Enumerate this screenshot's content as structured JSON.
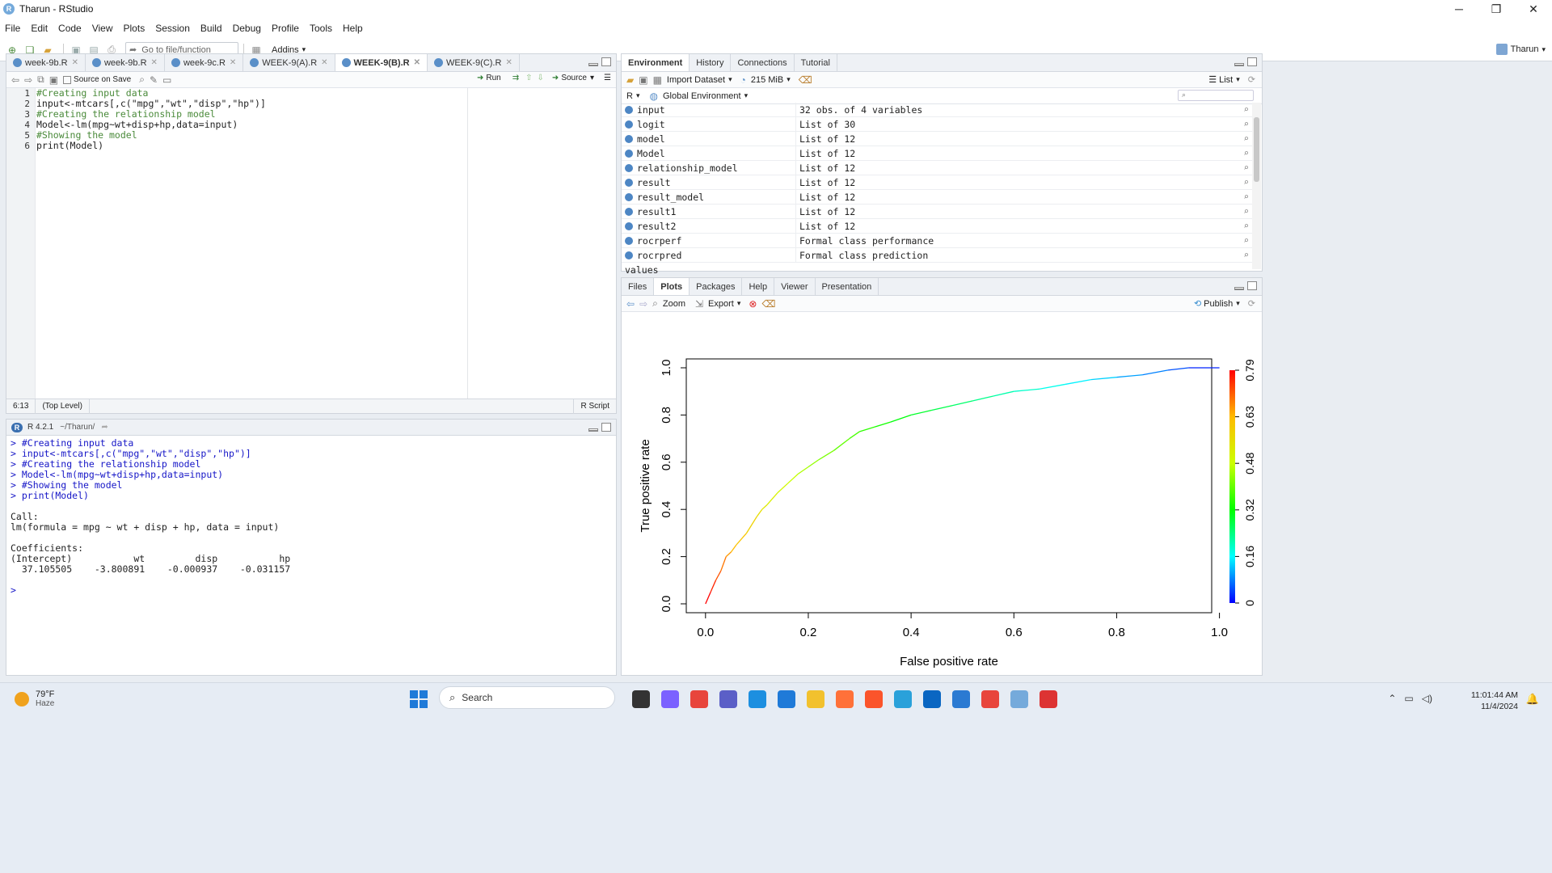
{
  "window": {
    "title": "Tharun - RStudio",
    "controls": [
      "─",
      "❐",
      "✕"
    ]
  },
  "menu": [
    "File",
    "Edit",
    "Code",
    "View",
    "Plots",
    "Session",
    "Build",
    "Debug",
    "Profile",
    "Tools",
    "Help"
  ],
  "toolbar": {
    "goto_placeholder": "Go to file/function",
    "addins": "Addins",
    "user": "Tharun"
  },
  "editor": {
    "tabs": [
      {
        "label": "week-9b.R",
        "active": false
      },
      {
        "label": "week-9b.R",
        "active": false
      },
      {
        "label": "week-9c.R",
        "active": false
      },
      {
        "label": "WEEK-9(A).R",
        "active": false
      },
      {
        "label": "WEEK-9(B).R",
        "active": true
      },
      {
        "label": "WEEK-9(C).R",
        "active": false
      }
    ],
    "source_on_save": "Source on Save",
    "run_label": "Run",
    "source_label": "Source",
    "line_numbers": [
      "1",
      "2",
      "3",
      "4",
      "5",
      "6"
    ],
    "lines": [
      "#Creating input data",
      "input<-mtcars[,c(\"mpg\",\"wt\",\"disp\",\"hp\")]",
      "#Creating the relationship model",
      "Model<-lm(mpg~wt+disp+hp,data=input)",
      "#Showing the model",
      "print(Model)"
    ],
    "cursor_pos": "6:13",
    "scope": "(Top Level)",
    "file_type": "R Script"
  },
  "console": {
    "version": "R 4.2.1",
    "path": "~/Tharun/",
    "lines": [
      {
        "text": "> #Creating input data",
        "type": "in"
      },
      {
        "text": "> input<-mtcars[,c(\"mpg\",\"wt\",\"disp\",\"hp\")]",
        "type": "in"
      },
      {
        "text": "> #Creating the relationship model",
        "type": "in"
      },
      {
        "text": "> Model<-lm(mpg~wt+disp+hp,data=input)",
        "type": "in"
      },
      {
        "text": "> #Showing the model",
        "type": "in"
      },
      {
        "text": "> print(Model)",
        "type": "in"
      },
      {
        "text": "",
        "type": "out"
      },
      {
        "text": "Call:",
        "type": "out"
      },
      {
        "text": "lm(formula = mpg ~ wt + disp + hp, data = input)",
        "type": "out"
      },
      {
        "text": "",
        "type": "out"
      },
      {
        "text": "Coefficients:",
        "type": "out"
      },
      {
        "text": "(Intercept)           wt         disp           hp  ",
        "type": "out"
      },
      {
        "text": "  37.105505    -3.800891    -0.000937    -0.031157  ",
        "type": "out"
      },
      {
        "text": "",
        "type": "out"
      },
      {
        "text": "> ",
        "type": "in"
      }
    ]
  },
  "environment": {
    "tabs": [
      "Environment",
      "History",
      "Connections",
      "Tutorial"
    ],
    "import_dataset": "Import Dataset",
    "memory": "215 MiB",
    "view_mode": "List",
    "lang": "R",
    "scope": "Global Environment",
    "rows": [
      {
        "name": "input",
        "value": "32 obs. of 4 variables"
      },
      {
        "name": "logit",
        "value": "List of  30"
      },
      {
        "name": "model",
        "value": "List of  12"
      },
      {
        "name": "Model",
        "value": "List of  12"
      },
      {
        "name": "relationship_model",
        "value": "List of  12"
      },
      {
        "name": "result",
        "value": "List of  12"
      },
      {
        "name": "result_model",
        "value": "List of  12"
      },
      {
        "name": "result1",
        "value": "List of  12"
      },
      {
        "name": "result2",
        "value": "List of  12"
      },
      {
        "name": "rocrperf",
        "value": "Formal class  performance"
      },
      {
        "name": "rocrpred",
        "value": "Formal class  prediction"
      }
    ],
    "section": "values"
  },
  "plots": {
    "tabs": [
      "Files",
      "Plots",
      "Packages",
      "Help",
      "Viewer",
      "Presentation"
    ],
    "zoom": "Zoom",
    "export": "Export",
    "publish": "Publish"
  },
  "chart_data": {
    "type": "line",
    "title": "",
    "xlabel": "False positive rate",
    "ylabel": "True positive rate",
    "xlim": [
      0,
      1
    ],
    "ylim": [
      0,
      1
    ],
    "x_ticks": [
      "0.0",
      "0.2",
      "0.4",
      "0.6",
      "0.8",
      "1.0"
    ],
    "y_ticks": [
      "0.0",
      "0.2",
      "0.4",
      "0.6",
      "0.8",
      "1.0"
    ],
    "colorbar_ticks": [
      "0",
      "0.16",
      "0.32",
      "0.48",
      "0.63",
      "0.79"
    ],
    "colorbar_range": [
      0,
      0.79
    ],
    "series": [
      {
        "x": [
          0.0,
          0.01,
          0.02,
          0.03,
          0.04,
          0.05,
          0.06,
          0.08,
          0.1,
          0.11,
          0.12,
          0.14,
          0.16,
          0.18,
          0.2,
          0.22,
          0.25,
          0.28,
          0.3,
          0.33,
          0.36,
          0.4,
          0.44,
          0.48,
          0.52,
          0.56,
          0.6,
          0.65,
          0.7,
          0.75,
          0.8,
          0.85,
          0.9,
          0.94,
          1.0
        ],
        "y": [
          0.0,
          0.05,
          0.1,
          0.14,
          0.2,
          0.22,
          0.25,
          0.3,
          0.37,
          0.4,
          0.42,
          0.47,
          0.51,
          0.55,
          0.58,
          0.61,
          0.65,
          0.7,
          0.73,
          0.75,
          0.77,
          0.8,
          0.82,
          0.84,
          0.86,
          0.88,
          0.9,
          0.91,
          0.93,
          0.95,
          0.96,
          0.97,
          0.99,
          1.0,
          1.0
        ],
        "cutoff": [
          0.79,
          0.76,
          0.72,
          0.69,
          0.66,
          0.63,
          0.61,
          0.58,
          0.55,
          0.53,
          0.51,
          0.49,
          0.47,
          0.45,
          0.43,
          0.41,
          0.39,
          0.37,
          0.35,
          0.33,
          0.31,
          0.29,
          0.27,
          0.25,
          0.23,
          0.21,
          0.19,
          0.17,
          0.15,
          0.13,
          0.1,
          0.08,
          0.05,
          0.02,
          0.0
        ]
      }
    ]
  },
  "taskbar": {
    "weather_temp": "79°F",
    "weather_desc": "Haze",
    "search": "Search",
    "time": "11:01:44 AM",
    "date": "11/4/2024",
    "apps": [
      "file-explorer-icon",
      "copilot-icon",
      "chrome-icon",
      "teams-icon",
      "edge-icon",
      "store-icon",
      "folder-icon",
      "firefox-icon",
      "brave-icon",
      "telegram-icon",
      "mail-icon",
      "vscode-icon",
      "chrome-alt-icon",
      "rstudio-icon",
      "snipping-icon"
    ]
  }
}
